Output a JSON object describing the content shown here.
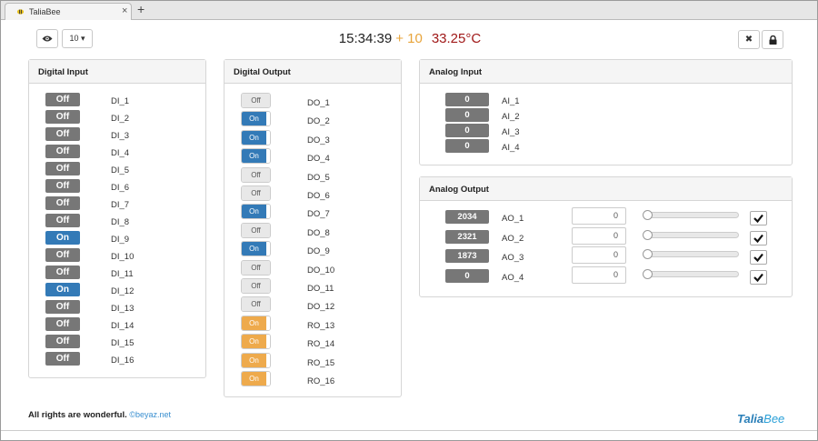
{
  "browser": {
    "tab_title": "TaliaBee",
    "close_glyph": "×",
    "new_tab_glyph": "+"
  },
  "toolbar": {
    "count_value": "10 ▾",
    "close_glyph": "✖"
  },
  "clock": {
    "time": "15:34:39",
    "offset": "+ 10",
    "temperature": "33.25°C"
  },
  "digital_input": {
    "title": "Digital Input",
    "rows": [
      {
        "name": "DI_1",
        "state": "Off"
      },
      {
        "name": "DI_2",
        "state": "Off"
      },
      {
        "name": "DI_3",
        "state": "Off"
      },
      {
        "name": "DI_4",
        "state": "Off"
      },
      {
        "name": "DI_5",
        "state": "Off"
      },
      {
        "name": "DI_6",
        "state": "Off"
      },
      {
        "name": "DI_7",
        "state": "Off"
      },
      {
        "name": "DI_8",
        "state": "Off"
      },
      {
        "name": "DI_9",
        "state": "On"
      },
      {
        "name": "DI_10",
        "state": "Off"
      },
      {
        "name": "DI_11",
        "state": "Off"
      },
      {
        "name": "DI_12",
        "state": "On"
      },
      {
        "name": "DI_13",
        "state": "Off"
      },
      {
        "name": "DI_14",
        "state": "Off"
      },
      {
        "name": "DI_15",
        "state": "Off"
      },
      {
        "name": "DI_16",
        "state": "Off"
      }
    ]
  },
  "digital_output": {
    "title": "Digital Output",
    "rows": [
      {
        "name": "DO_1",
        "state": "Off",
        "color": "gray"
      },
      {
        "name": "DO_2",
        "state": "On",
        "color": "#337ab7"
      },
      {
        "name": "DO_3",
        "state": "On",
        "color": "#337ab7"
      },
      {
        "name": "DO_4",
        "state": "On",
        "color": "#337ab7"
      },
      {
        "name": "DO_5",
        "state": "Off",
        "color": "gray"
      },
      {
        "name": "DO_6",
        "state": "Off",
        "color": "gray"
      },
      {
        "name": "DO_7",
        "state": "On",
        "color": "#337ab7"
      },
      {
        "name": "DO_8",
        "state": "Off",
        "color": "gray"
      },
      {
        "name": "DO_9",
        "state": "On",
        "color": "#337ab7"
      },
      {
        "name": "DO_10",
        "state": "Off",
        "color": "gray"
      },
      {
        "name": "DO_11",
        "state": "Off",
        "color": "gray"
      },
      {
        "name": "DO_12",
        "state": "Off",
        "color": "gray"
      },
      {
        "name": "RO_13",
        "state": "On",
        "color": "#eeaa4c"
      },
      {
        "name": "RO_14",
        "state": "On",
        "color": "#eeaa4c"
      },
      {
        "name": "RO_15",
        "state": "On",
        "color": "#eeaa4c"
      },
      {
        "name": "RO_16",
        "state": "On",
        "color": "#eeaa4c"
      }
    ]
  },
  "analog_input": {
    "title": "Analog Input",
    "rows": [
      {
        "name": "AI_1",
        "value": "0"
      },
      {
        "name": "AI_2",
        "value": "0"
      },
      {
        "name": "AI_3",
        "value": "0"
      },
      {
        "name": "AI_4",
        "value": "0"
      }
    ]
  },
  "analog_output": {
    "title": "Analog Output",
    "rows": [
      {
        "name": "AO_1",
        "value": "2034",
        "input": "0",
        "slider_fraction": 0
      },
      {
        "name": "AO_2",
        "value": "2321",
        "input": "0",
        "slider_fraction": 0
      },
      {
        "name": "AO_3",
        "value": "1873",
        "input": "0",
        "slider_fraction": 0
      },
      {
        "name": "AO_4",
        "value": "0",
        "input": "0",
        "slider_fraction": 0
      }
    ]
  },
  "footer": {
    "text": "All rights are wonderful.",
    "link": "©beyaz.net"
  },
  "logo": {
    "part1": "Talia",
    "part2": "Bee"
  }
}
